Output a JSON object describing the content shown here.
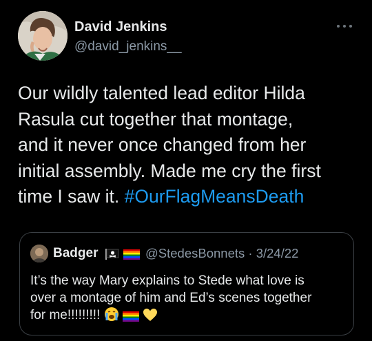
{
  "tweet": {
    "author_name": "David Jenkins",
    "author_handle": "@david_jenkins__",
    "more_icon": "more-horizontal-icon",
    "body_lines": [
      "Our wildly talented lead editor Hilda",
      "Rasula cut together that montage,",
      "and it never once changed from her",
      "initial assembly. Made me cry the first"
    ],
    "body_last_line_prefix": "time I saw it. ",
    "hashtag": "#OurFlagMeansDeath",
    "colors": {
      "background": "#000000",
      "text": "#e7e9ea",
      "secondary": "#8b98a5",
      "link": "#1d9bf0"
    }
  },
  "quote": {
    "author_name": "Badger",
    "name_emojis": [
      "pirate-flag-emoji",
      "rainbow-flag-emoji"
    ],
    "author_handle": "@StedesBonnets",
    "separator": "·",
    "date": "3/24/22",
    "text_lines": [
      "It’s the way Mary explains to Stede what love is",
      "over a montage of him and Ed’s scenes together"
    ],
    "text_last_line": "for me!!!!!!!!!",
    "text_emojis": [
      "crying-face-emoji",
      "rainbow-flag-emoji",
      "yellow-heart-emoji"
    ]
  }
}
